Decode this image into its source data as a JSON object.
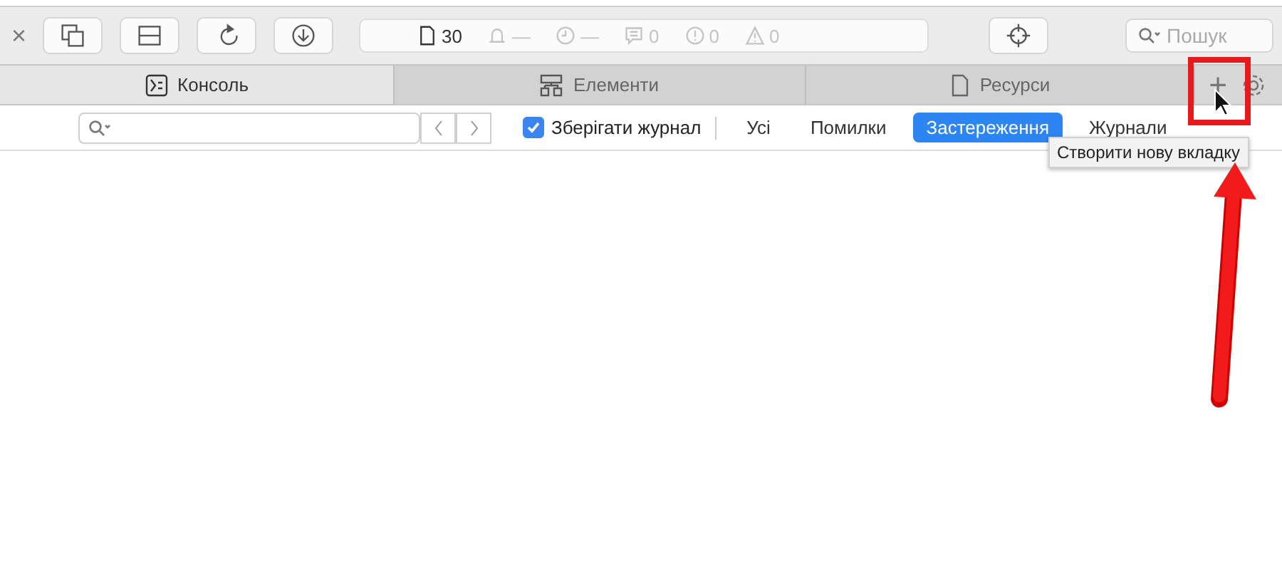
{
  "toolbar": {
    "close": "×",
    "counters": [
      {
        "kind": "resources",
        "text": "30"
      },
      {
        "kind": "bell",
        "text": "—"
      },
      {
        "kind": "clock",
        "text": "—"
      },
      {
        "kind": "log",
        "text": "0"
      },
      {
        "kind": "error",
        "text": "0"
      },
      {
        "kind": "warning",
        "text": "0"
      }
    ],
    "search": {
      "placeholder": "Пошук"
    }
  },
  "tabs": [
    {
      "label": "Консоль",
      "kind": "console",
      "selected": true
    },
    {
      "label": "Елементи",
      "kind": "elements",
      "selected": false
    },
    {
      "label": "Ресурси",
      "kind": "resources",
      "selected": false
    }
  ],
  "new_tab_button": "+",
  "filter_bar": {
    "preserve_log": {
      "label": "Зберігати журнал",
      "checked": true
    },
    "filters": [
      {
        "label": "Усі",
        "selected": false
      },
      {
        "label": "Помилки",
        "selected": false
      },
      {
        "label": "Застереження",
        "selected": true
      },
      {
        "label": "Журнали",
        "selected": false
      }
    ]
  },
  "tooltip": "Створити нову вкладку"
}
